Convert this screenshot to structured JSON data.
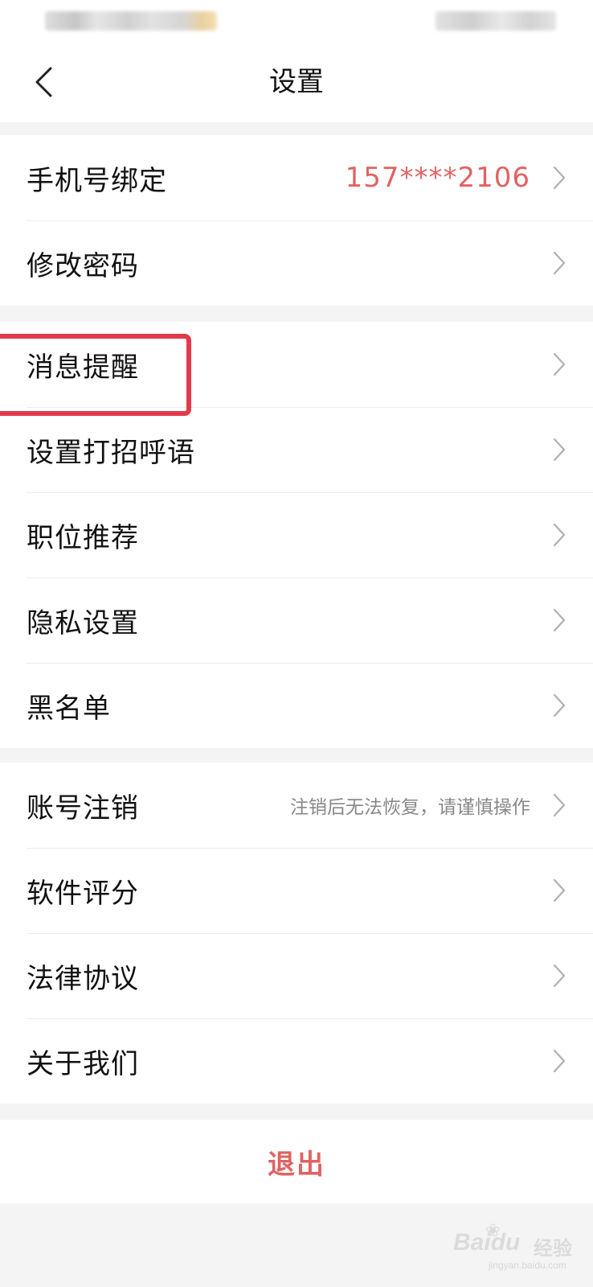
{
  "header": {
    "title": "设置",
    "back_icon": "chevron-left-icon"
  },
  "groups": [
    {
      "items": [
        {
          "label": "手机号绑定",
          "value": "157****2106"
        },
        {
          "label": "修改密码"
        }
      ]
    },
    {
      "items": [
        {
          "label": "消息提醒",
          "highlighted": true
        },
        {
          "label": "设置打招呼语"
        },
        {
          "label": "职位推荐"
        },
        {
          "label": "隐私设置"
        },
        {
          "label": "黑名单"
        }
      ]
    },
    {
      "items": [
        {
          "label": "账号注销",
          "hint": "注销后无法恢复，请谨慎操作"
        },
        {
          "label": "软件评分"
        },
        {
          "label": "法律协议"
        },
        {
          "label": "关于我们"
        }
      ]
    }
  ],
  "logout": {
    "label": "退出"
  },
  "watermark": {
    "brand": "Bai",
    "brand_suffix": "du",
    "cn": "经验",
    "url": "jingyan.baidu.com"
  },
  "colors": {
    "accent_red": "#e26262",
    "highlight_red": "#e23a4a",
    "hint_gray": "#888888",
    "page_bg": "#f4f4f4"
  },
  "icons": {
    "row_chevron": "chevron-right-icon"
  }
}
